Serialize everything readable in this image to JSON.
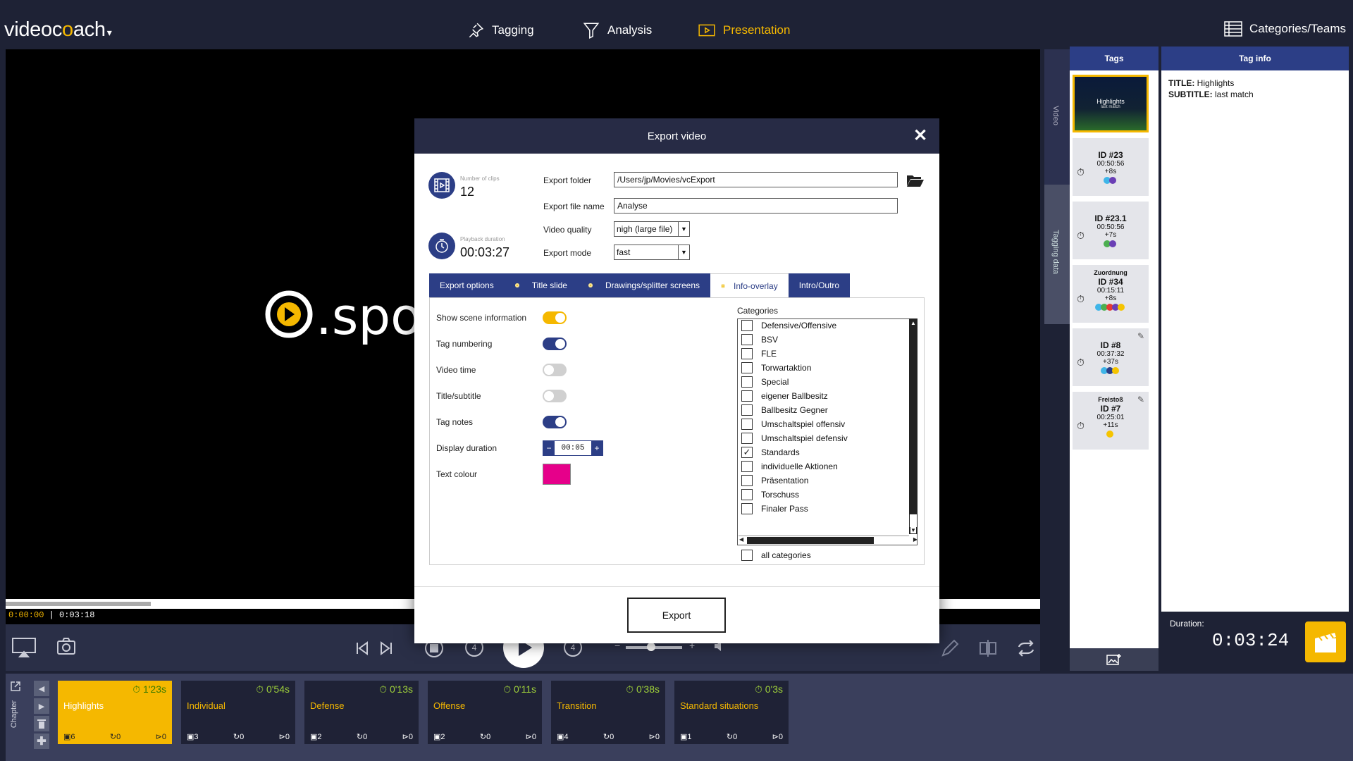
{
  "app": {
    "logo_a": "video",
    "logo_b": "c",
    "logo_c": "o",
    "logo_d": "ach",
    "logo_caret": "▾"
  },
  "nav": {
    "tagging": "Tagging",
    "analysis": "Analysis",
    "presentation": "Presentation",
    "categories": "Categories/Teams"
  },
  "player": {
    "side_tab_video": "Video",
    "side_tab_tagging": "Tagging data",
    "current_time": "0:00:00",
    "total_time": "0:03:18",
    "progress": 0.14,
    "volume": 0.45,
    "skip_back": "4",
    "skip_fwd": "4"
  },
  "tags": {
    "header": "Tags",
    "highlight_title": "Highlights",
    "highlight_sub": "last match",
    "cards": [
      {
        "label": "",
        "id": "ID #23",
        "time": "00:50:56",
        "len": "+8s",
        "dots": [
          "#3fb5e8",
          "#6a3fb5"
        ],
        "pen": false
      },
      {
        "label": "",
        "id": "ID #23.1",
        "time": "00:50:56",
        "len": "+7s",
        "dots": [
          "#4caf50",
          "#6a3fb5"
        ],
        "pen": false
      },
      {
        "label": "Zuordnung",
        "id": "ID #34",
        "time": "00:15:11",
        "len": "+8s",
        "dots": [
          "#3fb5e8",
          "#4caf50",
          "#e53935",
          "#6a3fb5",
          "#f5c400"
        ],
        "pen": false
      },
      {
        "label": "",
        "id": "ID #8",
        "time": "00:37:32",
        "len": "+37s",
        "dots": [
          "#3fb5e8",
          "#2c3e86",
          "#f5c400"
        ],
        "pen": true
      },
      {
        "label": "Freistoß",
        "id": "ID #7",
        "time": "00:25:01",
        "len": "+11s",
        "dots": [
          "#f5c400"
        ],
        "pen": true
      }
    ]
  },
  "taginfo": {
    "header": "Tag info",
    "title_key": "TITLE:",
    "title_val": " Highlights",
    "subtitle_key": "SUBTITLE:",
    "subtitle_val": " last match",
    "duration_label": "Duration:",
    "duration_value": "0:03:24"
  },
  "chapters": {
    "label": "Chapter",
    "items": [
      {
        "name": "Highlights",
        "dur": "1'23s",
        "clips": "6",
        "loops": "0",
        "plays": "0",
        "active": true
      },
      {
        "name": "Individual",
        "dur": "0'54s",
        "clips": "3",
        "loops": "0",
        "plays": "0",
        "active": false
      },
      {
        "name": "Defense",
        "dur": "0'13s",
        "clips": "2",
        "loops": "0",
        "plays": "0",
        "active": false
      },
      {
        "name": "Offense",
        "dur": "0'11s",
        "clips": "2",
        "loops": "0",
        "plays": "0",
        "active": false
      },
      {
        "name": "Transition",
        "dur": "0'38s",
        "clips": "4",
        "loops": "0",
        "plays": "0",
        "active": false
      },
      {
        "name": "Standard situations",
        "dur": "0'3s",
        "clips": "1",
        "loops": "0",
        "plays": "0",
        "active": false
      }
    ]
  },
  "modal": {
    "title": "Export video",
    "close": "✕",
    "clips_label": "Number of clips",
    "clips_value": "12",
    "playback_label": "Playback duration",
    "playback_value": "00:03:27",
    "folder_label": "Export folder",
    "folder_value": "/Users/jp/Movies/vcExport",
    "filename_label": "Export file name",
    "filename_value": "Analyse",
    "quality_label": "Video quality",
    "quality_value": "nigh (large file)",
    "mode_label": "Export mode",
    "mode_value": "fast",
    "tabs": [
      {
        "label": "Export options",
        "dot": false,
        "active": false
      },
      {
        "label": "Title slide",
        "dot": true,
        "active": false
      },
      {
        "label": "Drawings/splitter screens",
        "dot": true,
        "active": false
      },
      {
        "label": "Info-overlay",
        "dot": true,
        "active": true
      },
      {
        "label": "Intro/Outro",
        "dot": false,
        "active": false
      }
    ],
    "options": {
      "scene_info": "Show scene information",
      "tag_numbering": "Tag numbering",
      "video_time": "Video time",
      "title_subtitle": "Title/subtitle",
      "tag_notes": "Tag notes",
      "display_duration": "Display duration",
      "display_duration_value": "00:05",
      "text_colour": "Text colour",
      "text_colour_value": "#e6008a"
    },
    "categories_label": "Categories",
    "categories": [
      {
        "name": "Defensive/Offensive",
        "checked": false
      },
      {
        "name": "BSV",
        "checked": false
      },
      {
        "name": "FLE",
        "checked": false
      },
      {
        "name": "Torwartaktion",
        "checked": false
      },
      {
        "name": "Special",
        "checked": false
      },
      {
        "name": "eigener Ballbesitz",
        "checked": false
      },
      {
        "name": "Ballbesitz Gegner",
        "checked": false
      },
      {
        "name": "Umschaltspiel offensiv",
        "checked": false
      },
      {
        "name": "Umschaltspiel defensiv",
        "checked": false
      },
      {
        "name": "Standards",
        "checked": true
      },
      {
        "name": "individuelle Aktionen",
        "checked": false
      },
      {
        "name": "Präsentation",
        "checked": false
      },
      {
        "name": "Torschuss",
        "checked": false
      },
      {
        "name": "Finaler Pass",
        "checked": false
      }
    ],
    "all_categories": "all categories",
    "export_button": "Export"
  },
  "colors": {
    "accent": "#f5b800",
    "brand": "#2c3e86",
    "dark": "#1e2235"
  }
}
